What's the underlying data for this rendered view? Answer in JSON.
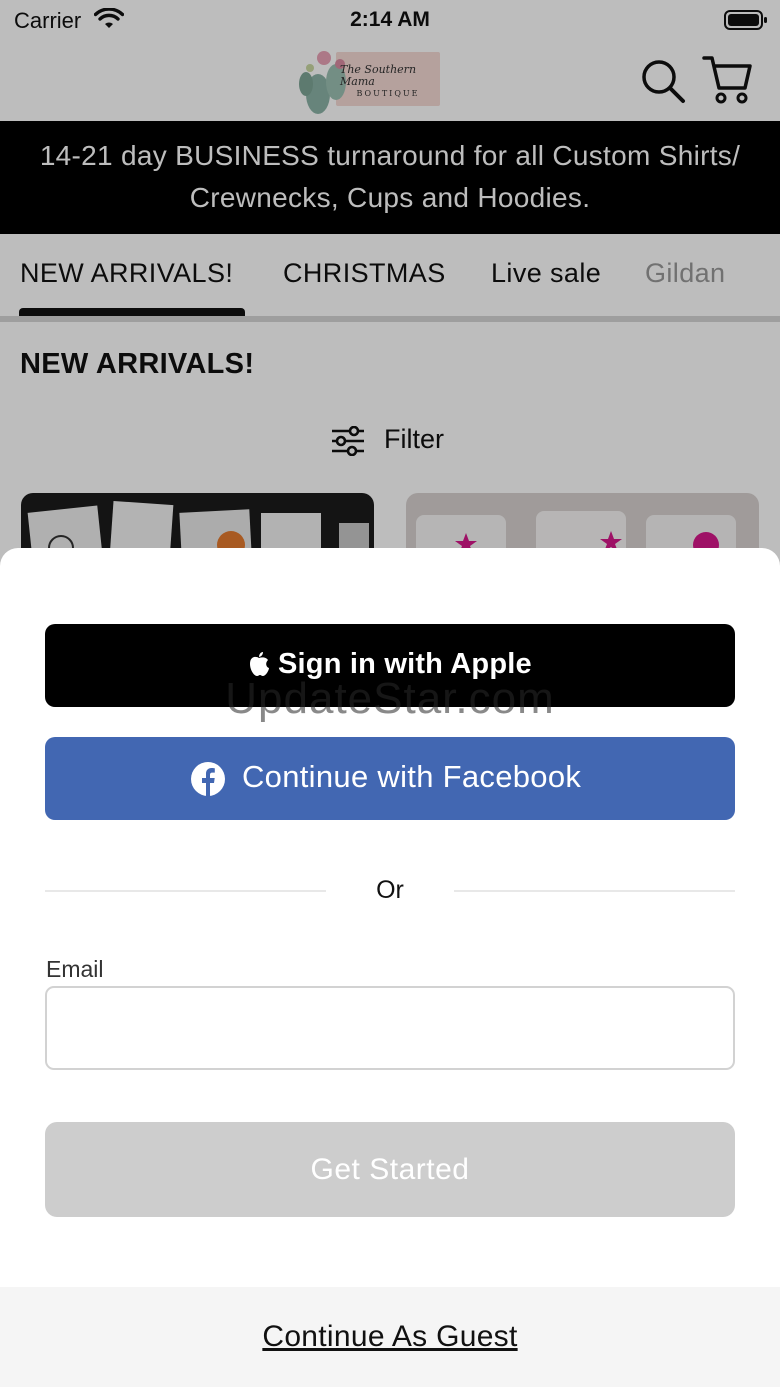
{
  "status_bar": {
    "carrier": "Carrier",
    "time": "2:14 AM"
  },
  "header": {
    "logo_text_line1": "The Southern Mama",
    "logo_text_line2": "BOUTIQUE",
    "search_icon": "search-icon",
    "cart_icon": "cart-icon"
  },
  "banner": {
    "line1": "14-21 day BUSINESS turnaround for all Custom Shirts/",
    "line2": "Crewnecks, Cups and Hoodies."
  },
  "tabs": [
    {
      "label": "NEW ARRIVALS!",
      "selected": true
    },
    {
      "label": "CHRISTMAS",
      "selected": false
    },
    {
      "label": "Live sale",
      "selected": false
    },
    {
      "label": "Gildan",
      "selected": false
    }
  ],
  "section": {
    "title": "NEW ARRIVALS!",
    "filter_label": "Filter"
  },
  "login_sheet": {
    "apple_label": "Sign in with Apple",
    "facebook_label": "Continue with Facebook",
    "watermark": "UpdateStar.com",
    "or_label": "Or",
    "email_label": "Email",
    "email_value": "",
    "email_placeholder": "",
    "get_started_label": "Get Started",
    "guest_label": "Continue As Guest"
  },
  "colors": {
    "banner_bg": "#000000",
    "facebook_blue": "#4267b2",
    "apple_black": "#000000",
    "disabled_gray": "#cdcdcd"
  }
}
